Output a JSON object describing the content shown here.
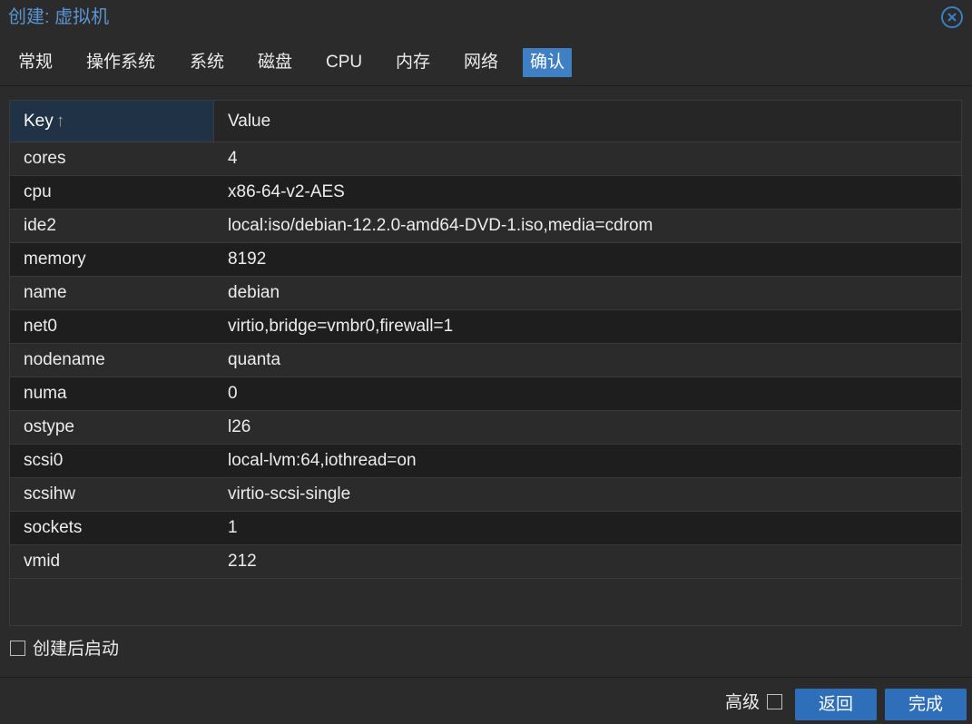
{
  "window": {
    "title": "创建: 虚拟机",
    "close_icon": "close-circle-icon",
    "accent": "#3f7fc3"
  },
  "tabs": [
    {
      "label": "常规"
    },
    {
      "label": "操作系统"
    },
    {
      "label": "系统"
    },
    {
      "label": "磁盘"
    },
    {
      "label": "CPU"
    },
    {
      "label": "内存"
    },
    {
      "label": "网络"
    },
    {
      "label": "确认",
      "active": true
    }
  ],
  "grid": {
    "columns": {
      "key": "Key",
      "value": "Value"
    },
    "sort_icon": "sort-ascending-icon",
    "sort_glyph": "↑",
    "rows": [
      {
        "key": "cores",
        "value": "4"
      },
      {
        "key": "cpu",
        "value": "x86-64-v2-AES"
      },
      {
        "key": "ide2",
        "value": "local:iso/debian-12.2.0-amd64-DVD-1.iso,media=cdrom"
      },
      {
        "key": "memory",
        "value": "8192"
      },
      {
        "key": "name",
        "value": "debian"
      },
      {
        "key": "net0",
        "value": "virtio,bridge=vmbr0,firewall=1"
      },
      {
        "key": "nodename",
        "value": "quanta"
      },
      {
        "key": "numa",
        "value": "0"
      },
      {
        "key": "ostype",
        "value": "l26"
      },
      {
        "key": "scsi0",
        "value": "local-lvm:64,iothread=on"
      },
      {
        "key": "scsihw",
        "value": "virtio-scsi-single"
      },
      {
        "key": "sockets",
        "value": "1"
      },
      {
        "key": "vmid",
        "value": "212"
      }
    ]
  },
  "start_after_create": {
    "label": "创建后启动",
    "checked": false
  },
  "footer": {
    "advanced_label": "高级",
    "advanced_checked": false,
    "back_label": "返回",
    "finish_label": "完成"
  }
}
